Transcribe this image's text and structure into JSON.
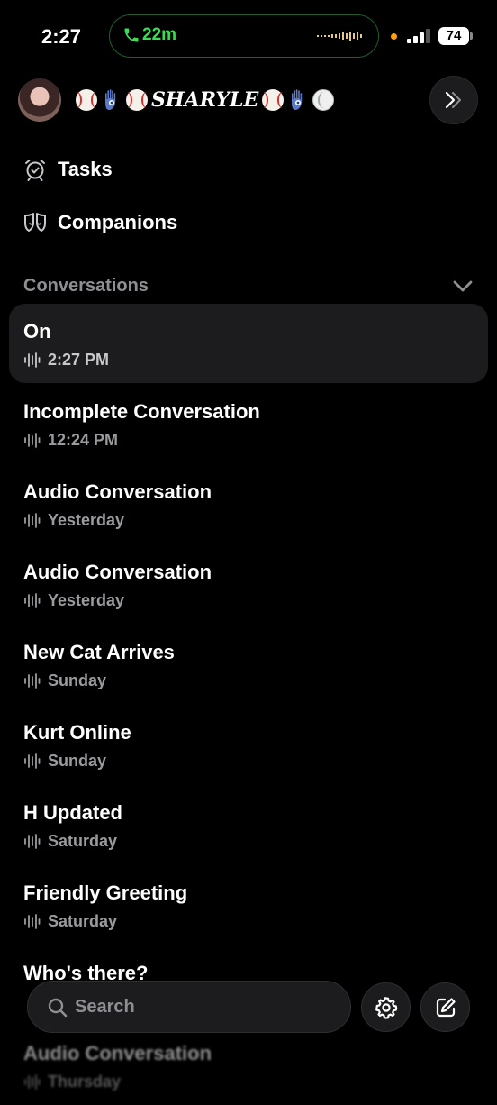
{
  "status": {
    "time": "2:27",
    "call_duration": "22m",
    "battery": "74"
  },
  "header": {
    "username": "SHARYLE"
  },
  "nav": [
    {
      "label": "Tasks",
      "icon": "alarm-clock-icon"
    },
    {
      "label": "Companions",
      "icon": "companions-icon"
    }
  ],
  "section": {
    "title": "Conversations"
  },
  "conversations": [
    {
      "title": "On",
      "time": "2:27 PM",
      "active": true
    },
    {
      "title": "Incomplete Conversation",
      "time": "12:24 PM"
    },
    {
      "title": "Audio Conversation",
      "time": "Yesterday"
    },
    {
      "title": "Audio Conversation",
      "time": "Yesterday"
    },
    {
      "title": "New Cat Arrives",
      "time": "Sunday"
    },
    {
      "title": "Kurt Online",
      "time": "Sunday"
    },
    {
      "title": "H Updated",
      "time": "Saturday"
    },
    {
      "title": "Friendly Greeting",
      "time": "Saturday"
    },
    {
      "title": "Who's there?",
      "time": ""
    },
    {
      "title": "Audio Conversation",
      "time": "Thursday"
    }
  ],
  "search": {
    "placeholder": "Search"
  },
  "colors": {
    "call_green": "#3ddc56",
    "accent_bg": "#1c1c1e"
  }
}
